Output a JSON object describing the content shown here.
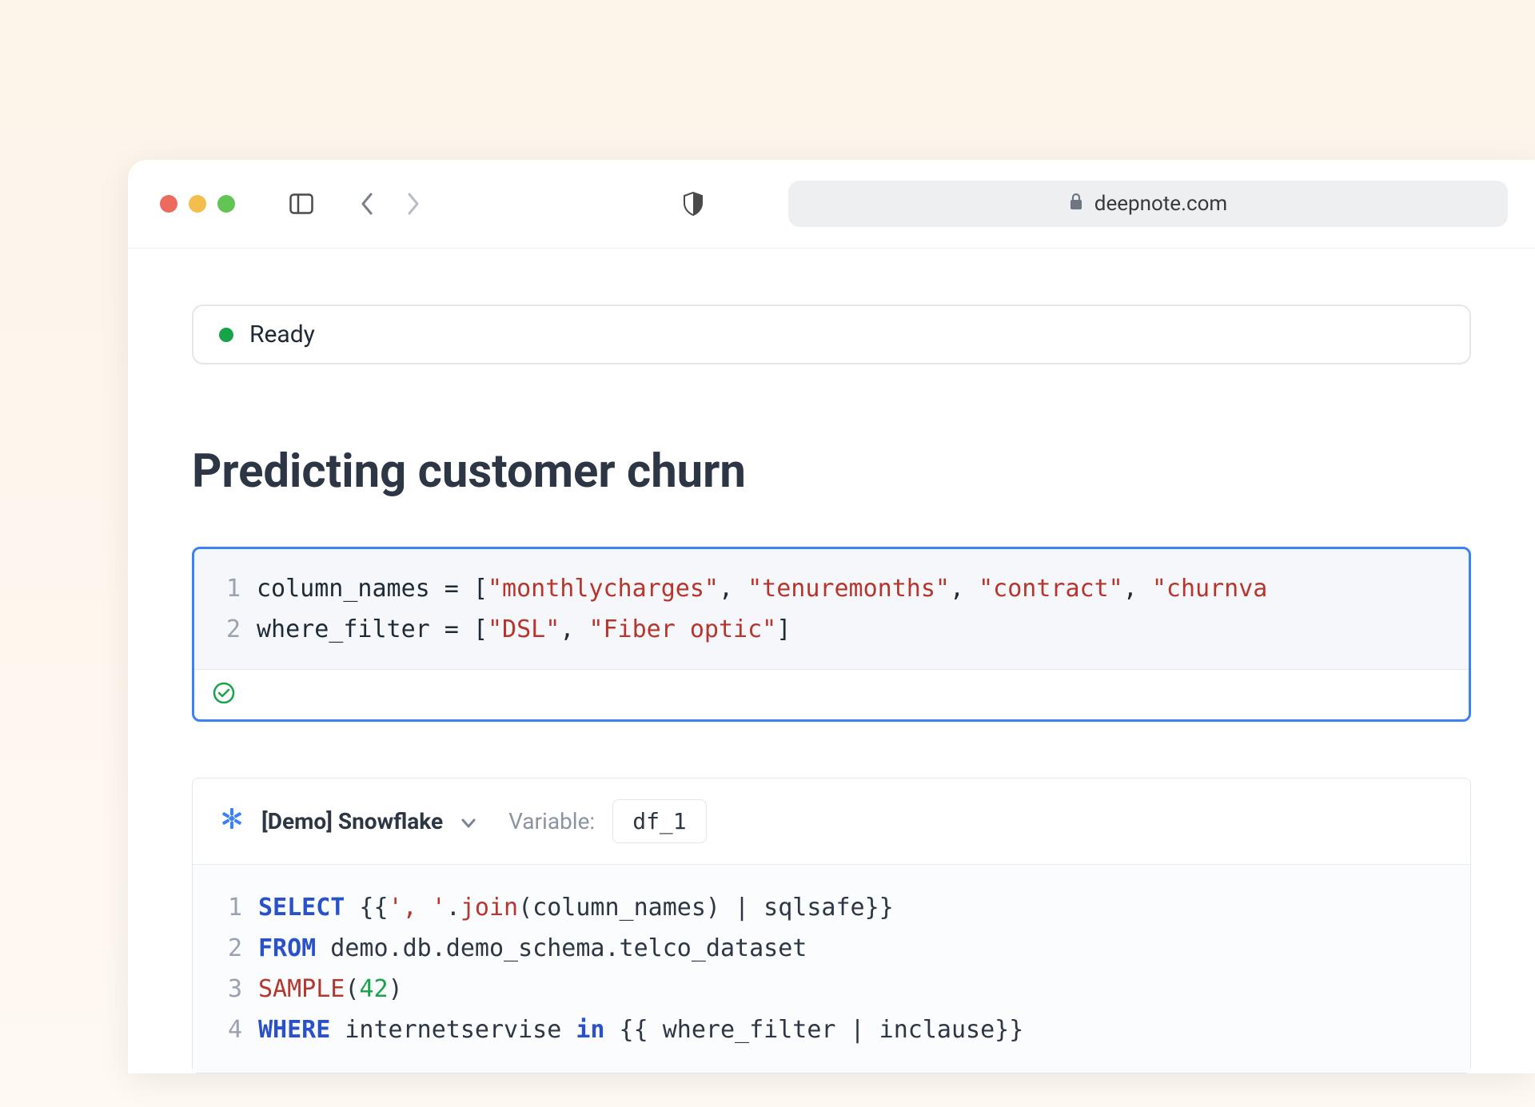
{
  "browser": {
    "domain": "deepnote.com"
  },
  "status": {
    "label": "Ready"
  },
  "title": "Predicting customer churn",
  "code_cell": {
    "line_numbers": [
      "1",
      "2"
    ],
    "line1": {
      "var": "column_names",
      "eq": " = ",
      "lb": "[",
      "s1": "\"monthlycharges\"",
      "c1": ", ",
      "s2": "\"tenuremonths\"",
      "c2": ", ",
      "s3": "\"contract\"",
      "c3": ", ",
      "s4": "\"churnva"
    },
    "line2": {
      "var": "where_filter",
      "eq": " = ",
      "lb": "[",
      "s1": "\"DSL\"",
      "c1": ", ",
      "s2": "\"Fiber optic\"",
      "rb": "]"
    }
  },
  "sql_cell": {
    "source_label": "[Demo] Snowflake",
    "variable_label": "Variable:",
    "variable_value": "df_1",
    "line_numbers": [
      "1",
      "2",
      "3",
      "4"
    ],
    "l1": {
      "kw": "SELECT",
      "rest_a": " {{",
      "str": "', '",
      "dot": ".",
      "fn": "join",
      "rest_b": "(column_names) | sqlsafe}}"
    },
    "l2": {
      "kw": "FROM",
      "rest": " demo.db.demo_schema.telco_dataset"
    },
    "l3": {
      "fn": "SAMPLE",
      "lp": "(",
      "num": "42",
      "rp": ")"
    },
    "l4": {
      "kw": "WHERE",
      "rest_a": " internetservise ",
      "kw2": "in",
      "rest_b": " {{ where_filter | inclause}}"
    }
  }
}
